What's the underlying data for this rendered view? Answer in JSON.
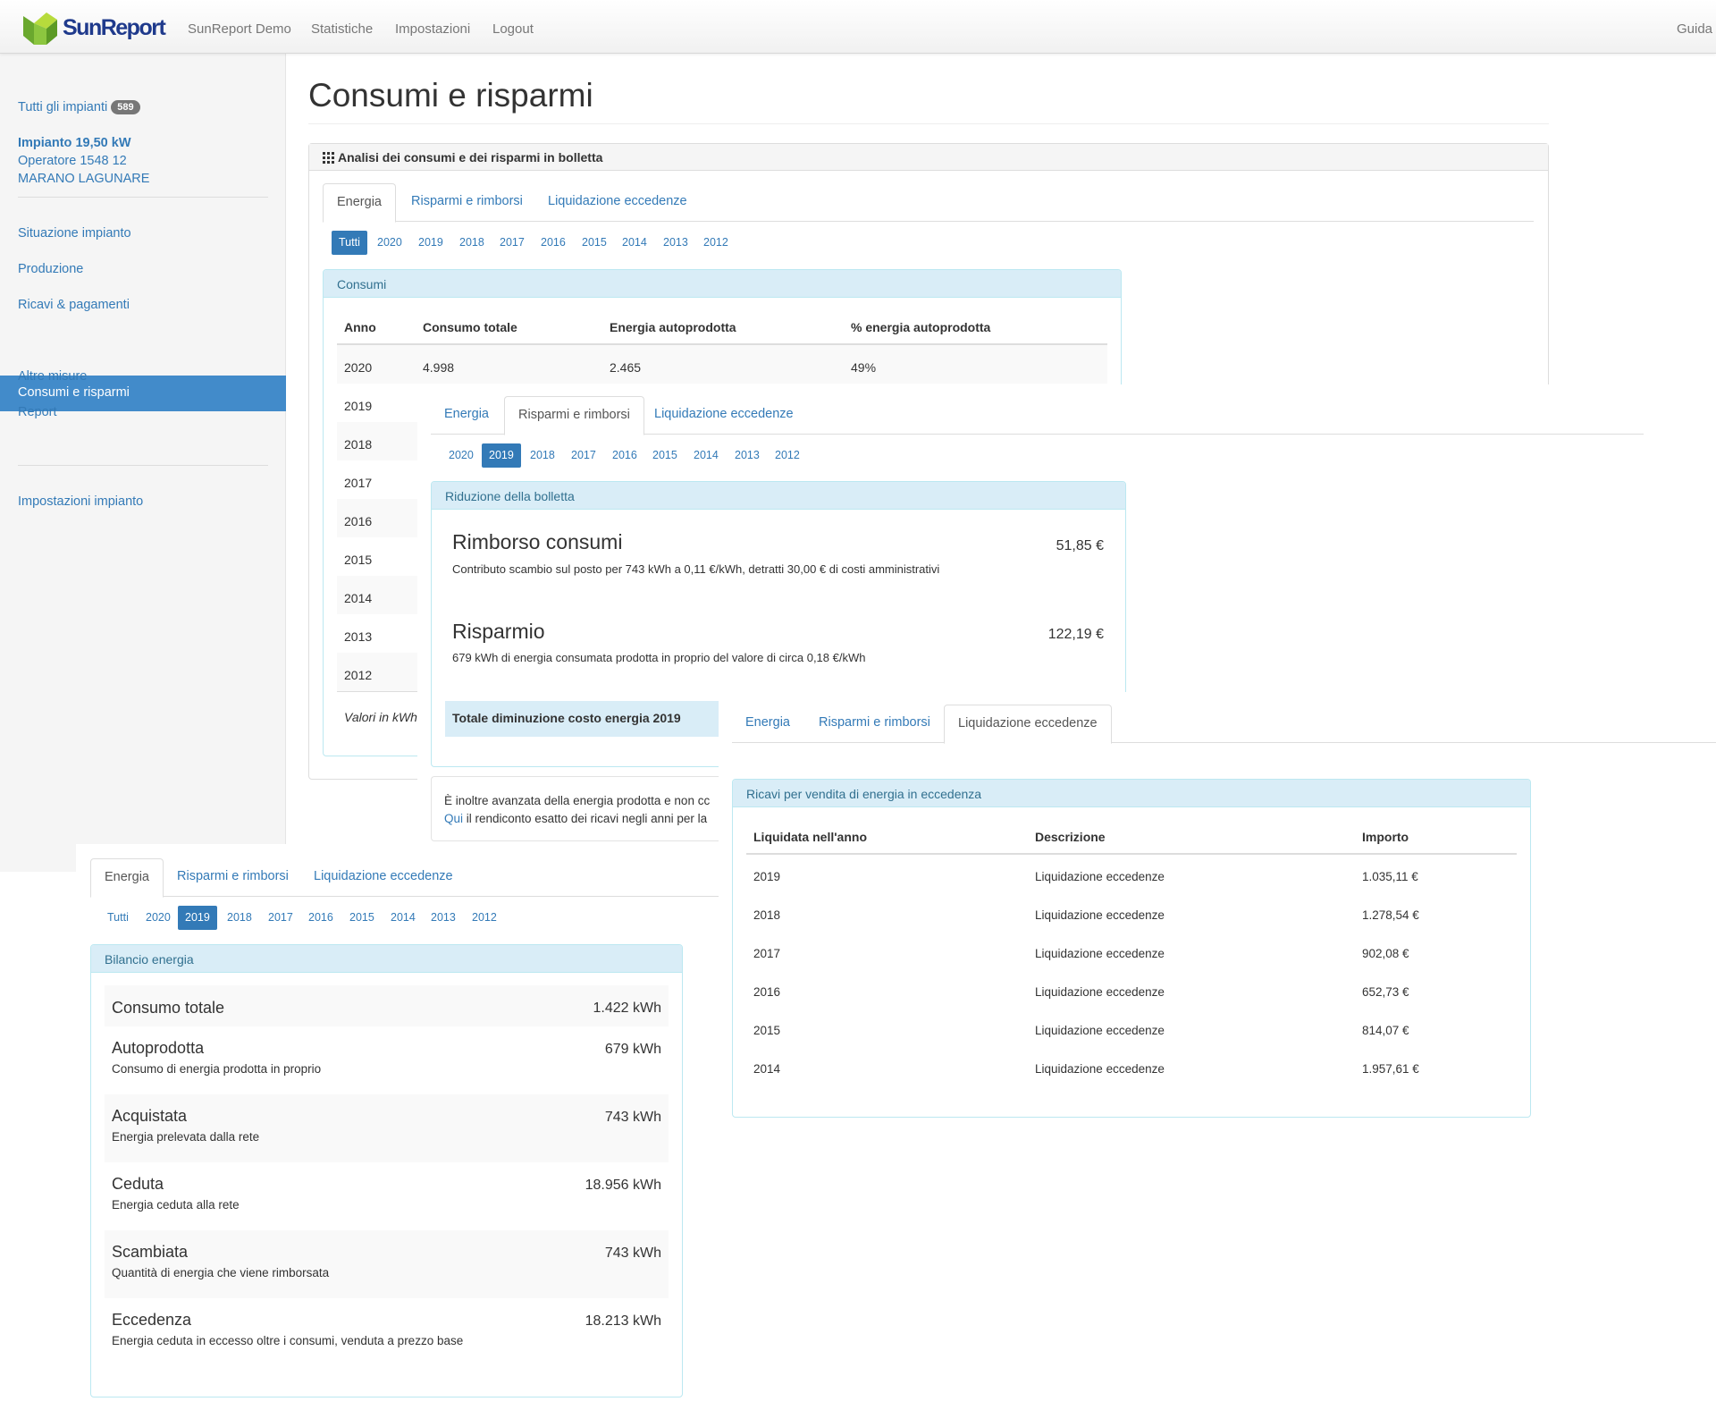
{
  "navbar": {
    "brand": "SunReport",
    "items": [
      "SunReport Demo",
      "Statistiche",
      "Impostazioni",
      "Logout"
    ],
    "help": "Guida"
  },
  "sidebar": {
    "all_plants_label": "Tutti gli impianti",
    "all_plants_count": "589",
    "plant_name": "Impianto 19,50 kW",
    "operator": "Operatore 1548 12",
    "location": "MARANO LAGUNARE",
    "items": [
      "Situazione impianto",
      "Produzione",
      "Ricavi & pagamenti",
      "Consumi e risparmi",
      "Altre misure",
      "Report"
    ],
    "settings": "Impostazioni impianto"
  },
  "page": {
    "title": "Consumi e risparmi",
    "panel_heading": "Analisi dei consumi e dei risparmi in bolletta"
  },
  "tabs": [
    "Energia",
    "Risparmi e rimborsi",
    "Liquidazione eccedenze"
  ],
  "years_all_label": "Tutti",
  "years": [
    "2020",
    "2019",
    "2018",
    "2017",
    "2016",
    "2015",
    "2014",
    "2013",
    "2012"
  ],
  "consumi": {
    "heading": "Consumi",
    "columns": [
      "Anno",
      "Consumo totale",
      "Energia autoprodotta",
      "% energia autoprodotta"
    ],
    "first_row": [
      "2020",
      "4.998",
      "2.465",
      "49%"
    ],
    "years": [
      "2019",
      "2018",
      "2017",
      "2016",
      "2015",
      "2014",
      "2013",
      "2012"
    ],
    "footer": "Valori in kWh"
  },
  "risparmi": {
    "heading": "Riduzione della bolletta",
    "rimborso_title": "Rimborso consumi",
    "rimborso_value": "51,85 €",
    "rimborso_desc": "Contributo scambio sul posto per 743 kWh a 0,11 €/kWh, detratti 30,00 € di costi amministrativi",
    "risparmio_title": "Risparmio",
    "risparmio_value": "122,19 €",
    "risparmio_desc": "679 kWh di energia consumata prodotta in proprio del valore di circa 0,18 €/kWh",
    "total_label": "Totale diminuzione costo energia 2019",
    "note_line1": "È inoltre avanzata della energia prodotta e non cc",
    "note_link": "Qui",
    "note_line2": " il rendiconto esatto dei ricavi negli anni per la"
  },
  "liquidazione": {
    "heading": "Ricavi per vendita di energia in eccedenza",
    "columns": [
      "Liquidata nell'anno",
      "Descrizione",
      "Importo"
    ],
    "rows": [
      [
        "2019",
        "Liquidazione eccedenze",
        "1.035,11 €"
      ],
      [
        "2018",
        "Liquidazione eccedenze",
        "1.278,54 €"
      ],
      [
        "2017",
        "Liquidazione eccedenze",
        "902,08 €"
      ],
      [
        "2016",
        "Liquidazione eccedenze",
        "652,73 €"
      ],
      [
        "2015",
        "Liquidazione eccedenze",
        "814,07 €"
      ],
      [
        "2014",
        "Liquidazione eccedenze",
        "1.957,61 €"
      ]
    ]
  },
  "bilancio": {
    "heading": "Bilancio energia",
    "total_label": "Consumo totale",
    "total_value": "1.422 kWh",
    "items": [
      {
        "label": "Autoprodotta",
        "desc": "Consumo di energia prodotta in proprio",
        "value": "679 kWh"
      },
      {
        "label": "Acquistata",
        "desc": "Energia prelevata dalla rete",
        "value": "743 kWh"
      },
      {
        "label": "Ceduta",
        "desc": "Energia ceduta alla rete",
        "value": "18.956 kWh"
      },
      {
        "label": "Scambiata",
        "desc": "Quantità di energia che viene rimborsata",
        "value": "743 kWh"
      },
      {
        "label": "Eccedenza",
        "desc": "Energia ceduta in eccesso oltre i consumi, venduta a prezzo base",
        "value": "18.213 kWh"
      }
    ]
  },
  "colors": {
    "link": "#337ab7",
    "active_nav": "#428bca",
    "info_bg": "#d9edf7",
    "brand_green": "#8cc63f",
    "brand_blue": "#1f3a8c"
  }
}
